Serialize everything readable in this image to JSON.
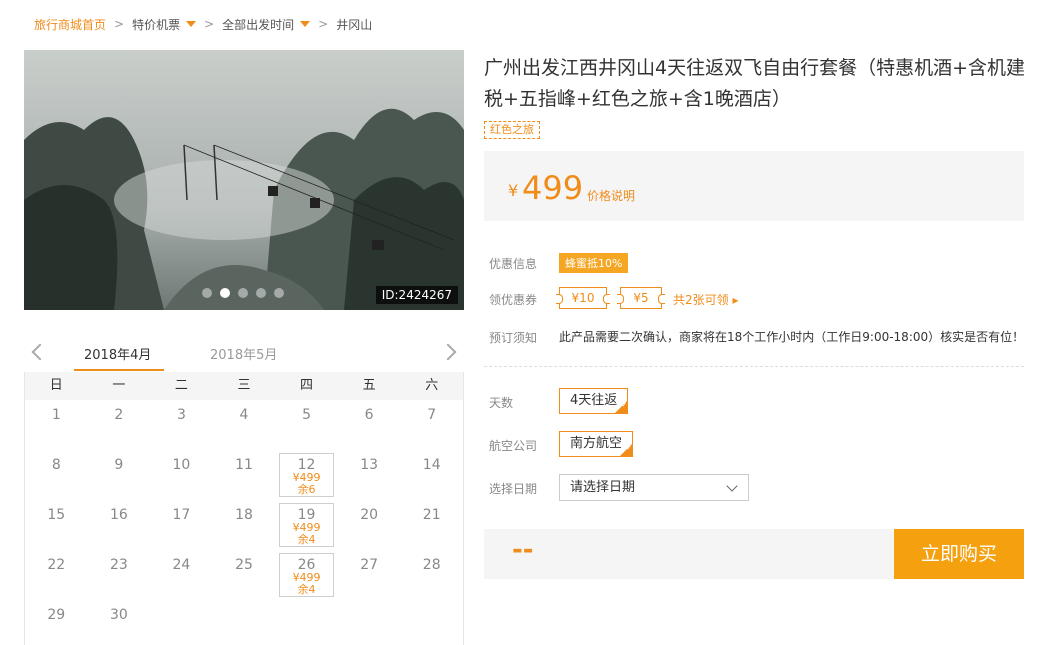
{
  "breadcrumb": {
    "home": "旅行商城首页",
    "sep": ">",
    "items": [
      {
        "label": "特价机票"
      },
      {
        "label": "全部出发时间"
      },
      {
        "label": "井冈山"
      }
    ]
  },
  "gallery": {
    "image_id": "ID:2424267",
    "dot_count": 5,
    "active_dot": 1
  },
  "calendar": {
    "tabs": [
      "2018年4月",
      "2018年5月"
    ],
    "active_tab": 0,
    "weekdays": [
      "日",
      "一",
      "二",
      "三",
      "四",
      "五",
      "六"
    ],
    "days": [
      {
        "d": "1"
      },
      {
        "d": "2"
      },
      {
        "d": "3"
      },
      {
        "d": "4"
      },
      {
        "d": "5"
      },
      {
        "d": "6"
      },
      {
        "d": "7"
      },
      {
        "d": "8"
      },
      {
        "d": "9"
      },
      {
        "d": "10"
      },
      {
        "d": "11"
      },
      {
        "d": "12",
        "price": "¥499",
        "stock": "余6"
      },
      {
        "d": "13"
      },
      {
        "d": "14"
      },
      {
        "d": "15"
      },
      {
        "d": "16"
      },
      {
        "d": "17"
      },
      {
        "d": "18"
      },
      {
        "d": "19",
        "price": "¥499",
        "stock": "余4"
      },
      {
        "d": "20"
      },
      {
        "d": "21"
      },
      {
        "d": "22"
      },
      {
        "d": "23"
      },
      {
        "d": "24"
      },
      {
        "d": "25"
      },
      {
        "d": "26",
        "price": "¥499",
        "stock": "余4"
      },
      {
        "d": "27"
      },
      {
        "d": "28"
      },
      {
        "d": "29"
      },
      {
        "d": "30"
      }
    ]
  },
  "product": {
    "title": "广州出发江西井冈山4天往返双飞自由行套餐（特惠机酒+含机建税+五指峰+红色之旅+含1晚酒店）",
    "tag": "红色之旅",
    "currency": "¥",
    "price": "499",
    "price_note": "价格说明"
  },
  "info": {
    "promo_label": "优惠信息",
    "promo_badge": "蜂蜜抵10%",
    "coupon_label": "领优惠券",
    "coupons": [
      "¥10",
      "¥5"
    ],
    "coupon_link": "共2张可领 ▸",
    "notice_label": "预订须知",
    "notice_text": "此产品需要二次确认，商家将在18个工作小时内（工作日9:00-18:00）核实是否有位！"
  },
  "options": {
    "days_label": "天数",
    "days_value": "4天往返",
    "airline_label": "航空公司",
    "airline_value": "南方航空",
    "date_label": "选择日期",
    "date_placeholder": "请选择日期"
  },
  "buy": {
    "total": "--",
    "button": "立即购买"
  },
  "colors": {
    "accent": "#f08c1a",
    "buy_button": "#f5a00f",
    "badge": "#f5a623"
  }
}
